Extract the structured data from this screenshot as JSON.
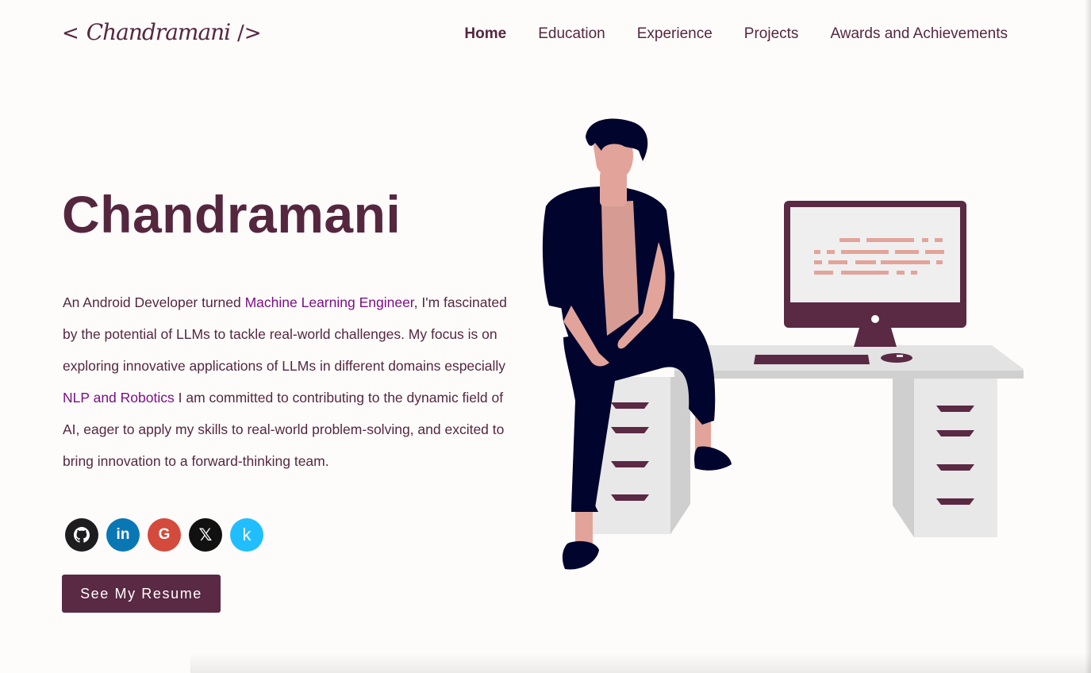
{
  "header": {
    "logo_open": "<",
    "logo_name": "Chandramani",
    "logo_close": "/>",
    "nav": [
      {
        "label": "Home",
        "active": true
      },
      {
        "label": "Education"
      },
      {
        "label": "Experience"
      },
      {
        "label": "Projects"
      },
      {
        "label": "Awards and Achievements"
      }
    ]
  },
  "hero": {
    "title": "Chandramani",
    "bio": {
      "p1": "An Android Developer turned ",
      "hl1": "Machine Learning Engineer",
      "p2": ", I'm fascinated by the potential of LLMs to tackle real-world challenges. My focus is on exploring innovative applications of LLMs in different domains especially ",
      "hl2": "NLP and Robotics",
      "p3": " I am committed to contributing to the dynamic field of AI, eager to apply my skills to real-world problem-solving, and excited to bring innovation to a forward-thinking team."
    },
    "socials": [
      {
        "icon": "github-icon"
      },
      {
        "icon": "linkedin-icon",
        "glyph": "in"
      },
      {
        "icon": "google-icon",
        "glyph": "G"
      },
      {
        "icon": "x-icon",
        "glyph": "𝕏"
      },
      {
        "icon": "kaggle-icon",
        "glyph": "k"
      }
    ],
    "resume_label": "See My Resume"
  },
  "colors": {
    "primary": "#55273f",
    "highlight": "#7b0f86",
    "button": "#5a2944",
    "background": "#fefcfb"
  }
}
